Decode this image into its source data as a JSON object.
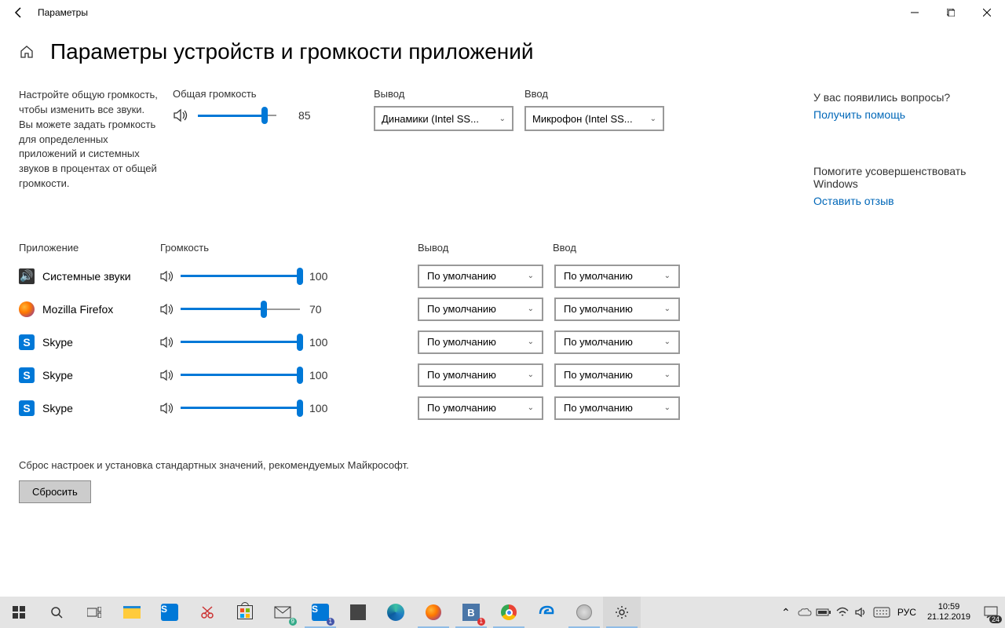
{
  "window": {
    "title": "Параметры"
  },
  "page_title": "Параметры устройств и громкости приложений",
  "master": {
    "desc": "Настройте общую громкость, чтобы изменить все звуки. Вы можете задать громкость для определенных приложений и системных звуков в процентах от общей громкости.",
    "vol_label": "Общая громкость",
    "volume": 85,
    "output_label": "Вывод",
    "output_selected": "Динамики (Intel SS...",
    "input_label": "Ввод",
    "input_selected": "Микрофон (Intel SS..."
  },
  "apps": {
    "col_app": "Приложение",
    "col_vol": "Громкость",
    "col_out": "Вывод",
    "col_in": "Ввод",
    "rows": [
      {
        "icon": "system",
        "name": "Системные звуки",
        "vol": 100,
        "out": "По умолчанию",
        "in": "По умолчанию"
      },
      {
        "icon": "firefox",
        "name": "Mozilla Firefox",
        "vol": 70,
        "out": "По умолчанию",
        "in": "По умолчанию"
      },
      {
        "icon": "skype",
        "name": "Skype",
        "vol": 100,
        "out": "По умолчанию",
        "in": "По умолчанию"
      },
      {
        "icon": "skype",
        "name": "Skype",
        "vol": 100,
        "out": "По умолчанию",
        "in": "По умолчанию"
      },
      {
        "icon": "skype",
        "name": "Skype",
        "vol": 100,
        "out": "По умолчанию",
        "in": "По умолчанию"
      }
    ]
  },
  "reset": {
    "text": "Сброс настроек и установка стандартных значений, рекомендуемых Майкрософт.",
    "button": "Сбросить"
  },
  "sidebar": {
    "questions_title": "У вас появились вопросы?",
    "help_link": "Получить помощь",
    "improve_title": "Помогите усовершенствовать Windows",
    "feedback_link": "Оставить отзыв"
  },
  "taskbar": {
    "lang": "РУС",
    "time": "10:59",
    "date": "21.12.2019",
    "notif_badge": "24"
  }
}
